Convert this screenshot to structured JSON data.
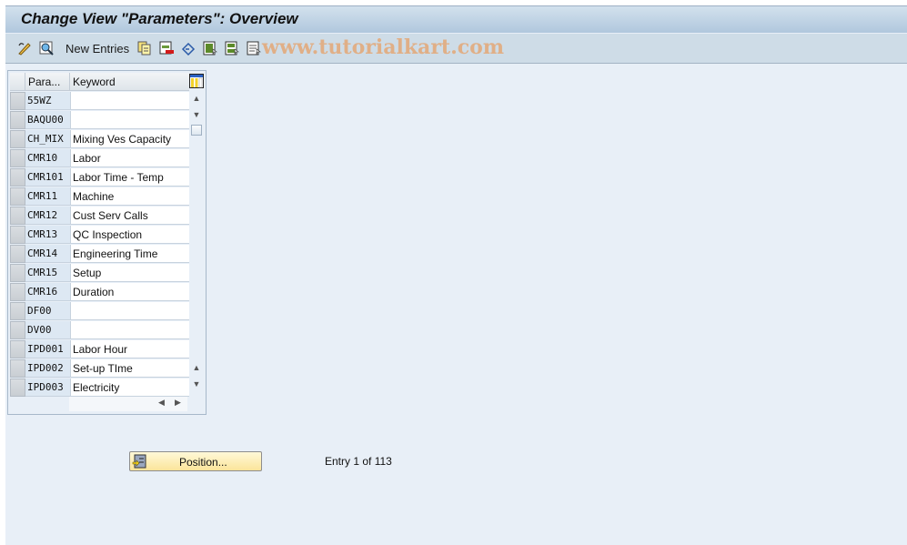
{
  "title": "Change View \"Parameters\": Overview",
  "toolbar": {
    "icons": [
      "display-change-icon",
      "details-icon"
    ],
    "new_entries_label": "New Entries",
    "icons_after": [
      "copy-as-icon",
      "delete-icon",
      "undo-change-icon",
      "select-all-icon",
      "select-block-icon",
      "deselect-all-icon"
    ],
    "watermark": "www.tutorialkart.com"
  },
  "table": {
    "columns": [
      "Para...",
      "Keyword"
    ],
    "rows": [
      {
        "param": "55WZ",
        "keyword": ""
      },
      {
        "param": "BAQU00",
        "keyword": ""
      },
      {
        "param": "CH_MIX",
        "keyword": "Mixing Ves Capacity"
      },
      {
        "param": "CMR10",
        "keyword": "Labor"
      },
      {
        "param": "CMR101",
        "keyword": "Labor Time - Temp"
      },
      {
        "param": "CMR11",
        "keyword": "Machine"
      },
      {
        "param": "CMR12",
        "keyword": "Cust Serv Calls"
      },
      {
        "param": "CMR13",
        "keyword": "QC Inspection"
      },
      {
        "param": "CMR14",
        "keyword": "Engineering Time"
      },
      {
        "param": "CMR15",
        "keyword": "Setup"
      },
      {
        "param": "CMR16",
        "keyword": "Duration"
      },
      {
        "param": "DF00",
        "keyword": ""
      },
      {
        "param": "DV00",
        "keyword": ""
      },
      {
        "param": "IPD001",
        "keyword": "Labor Hour"
      },
      {
        "param": "IPD002",
        "keyword": "Set-up TIme"
      },
      {
        "param": "IPD003",
        "keyword": "Electricity"
      }
    ]
  },
  "footer": {
    "position_label": "Position...",
    "entry_text": "Entry 1 of 113"
  }
}
